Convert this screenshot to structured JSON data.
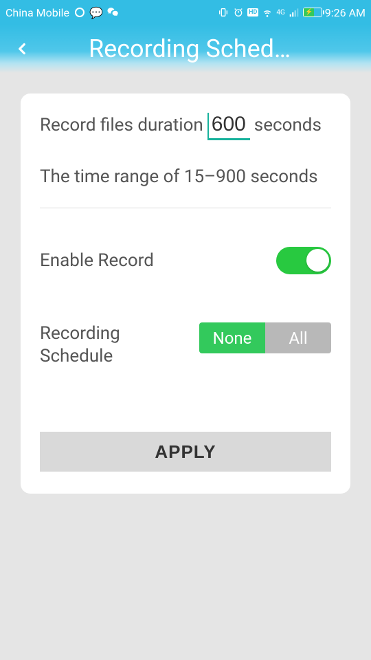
{
  "status_bar": {
    "carrier": "China Mobile",
    "time": "9:26 AM",
    "network_badge": "HD",
    "signal4g": "4G"
  },
  "header": {
    "title": "Recording Sched…"
  },
  "card": {
    "duration": {
      "prefix": "Record files duration",
      "value": "600",
      "suffix": "seconds"
    },
    "range_text": "The time range of 15–900 seconds",
    "enable": {
      "label": "Enable Record",
      "state": true
    },
    "schedule": {
      "label_line1": "Recording",
      "label_line2": "Schedule",
      "options": {
        "none": "None",
        "all": "All"
      },
      "selected": "none"
    },
    "apply_label": "APPLY"
  }
}
